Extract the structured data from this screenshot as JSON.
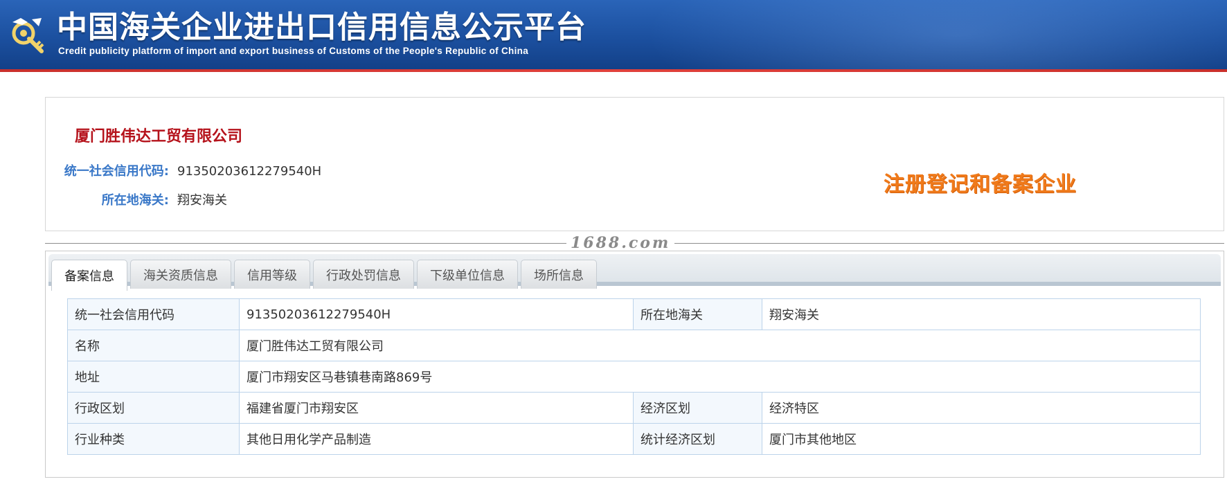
{
  "header": {
    "title": "中国海关企业进出口信用信息公示平台",
    "subtitle": "Credit publicity platform of import and export business of Customs of the People's Republic of China",
    "emblem_icon": "customs-emblem-icon",
    "colors": {
      "banner": "#1b4f9e",
      "stripe": "#c9302c"
    }
  },
  "summary": {
    "company_name": "厦门胜伟达工贸有限公司",
    "credit_code_label": "统一社会信用代码:",
    "credit_code_value": "91350203612279540H",
    "customs_label": "所在地海关:",
    "customs_value": "翔安海关",
    "status_badge": "注册登记和备案企业",
    "colors": {
      "name": "#b5121b",
      "label": "#3a78c8",
      "badge": "#f07a1a"
    }
  },
  "watermark": "1688.com",
  "tabs": [
    {
      "label": "备案信息",
      "active": true
    },
    {
      "label": "海关资质信息",
      "active": false
    },
    {
      "label": "信用等级",
      "active": false
    },
    {
      "label": "行政处罚信息",
      "active": false
    },
    {
      "label": "下级单位信息",
      "active": false
    },
    {
      "label": "场所信息",
      "active": false
    }
  ],
  "detail": {
    "rows": [
      {
        "label1": "统一社会信用代码",
        "value1": "91350203612279540H",
        "label2": "所在地海关",
        "value2": "翔安海关"
      },
      {
        "label1": "名称",
        "value1": "厦门胜伟达工贸有限公司"
      },
      {
        "label1": "地址",
        "value1": "厦门市翔安区马巷镇巷南路869号"
      },
      {
        "label1": "行政区划",
        "value1": "福建省厦门市翔安区",
        "label2": "经济区划",
        "value2": "经济特区"
      },
      {
        "label1": "行业种类",
        "value1": "其他日用化学产品制造",
        "label2": "统计经济区划",
        "value2": "厦门市其他地区"
      }
    ]
  }
}
